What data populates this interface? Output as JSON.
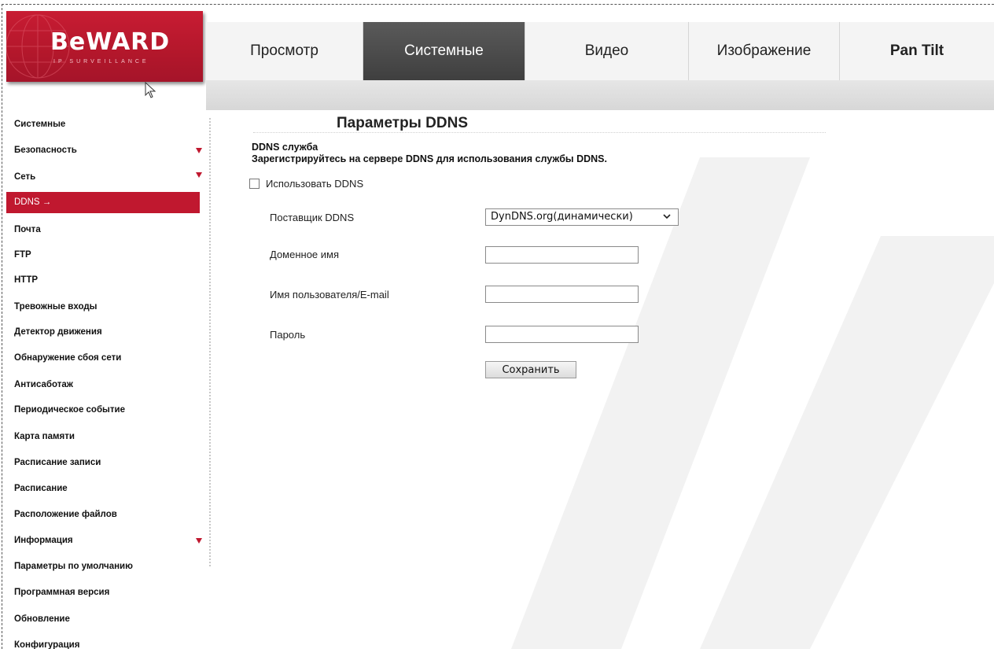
{
  "brand": {
    "logo_text": "BeWARD",
    "logo_sub": "IP SURVEILLANCE"
  },
  "tabs": [
    {
      "label": "Просмотр",
      "active": false
    },
    {
      "label": "Системные",
      "active": true
    },
    {
      "label": "Видео",
      "active": false
    },
    {
      "label": "Изображение",
      "active": false
    },
    {
      "label": "Pan Tilt",
      "active": false
    }
  ],
  "sidebar": {
    "items": [
      {
        "label": "Системные",
        "expandable": false
      },
      {
        "label": "Безопасность",
        "expandable": true
      },
      {
        "label": "Сеть",
        "expandable": true
      },
      {
        "label": "DDNS",
        "active": true,
        "arrow": "→"
      },
      {
        "label": "Почта"
      },
      {
        "label": "FTP"
      },
      {
        "label": "HTTP"
      },
      {
        "label": "Тревожные входы"
      },
      {
        "label": "Детектор движения"
      },
      {
        "label": "Обнаружение сбоя сети"
      },
      {
        "label": "Антисаботаж"
      },
      {
        "label": "Периодическое событие"
      },
      {
        "label": "Карта памяти"
      },
      {
        "label": "Расписание записи"
      },
      {
        "label": "Расписание"
      },
      {
        "label": "Расположение файлов"
      },
      {
        "label": "Информация",
        "expandable": true
      },
      {
        "label": "Параметры по умолчанию"
      },
      {
        "label": "Программная версия"
      },
      {
        "label": "Обновление"
      },
      {
        "label": "Конфигурация"
      }
    ]
  },
  "main": {
    "title": "Параметры DDNS",
    "service_title": "DDNS служба",
    "service_desc": "Зарегистрируйтесь на сервере DDNS для использования службы DDNS.",
    "use_ddns": {
      "label": "Использовать DDNS",
      "checked": false
    },
    "provider": {
      "label": "Поставщик DDNS",
      "value": "DynDNS.org(динамически)"
    },
    "domain": {
      "label": "Доменное имя",
      "value": ""
    },
    "username": {
      "label": "Имя пользователя/E-mail",
      "value": ""
    },
    "password": {
      "label": "Пароль",
      "value": ""
    },
    "save_label": "Сохранить"
  },
  "colors": {
    "brand_red": "#c0182f",
    "active_tab": "#4a4a4a"
  },
  "icons": [
    "globe-icon",
    "cursor-icon",
    "dropdown-arrow-icon",
    "chevron-down-icon",
    "checkbox-icon",
    "watermark-logo-icon"
  ]
}
